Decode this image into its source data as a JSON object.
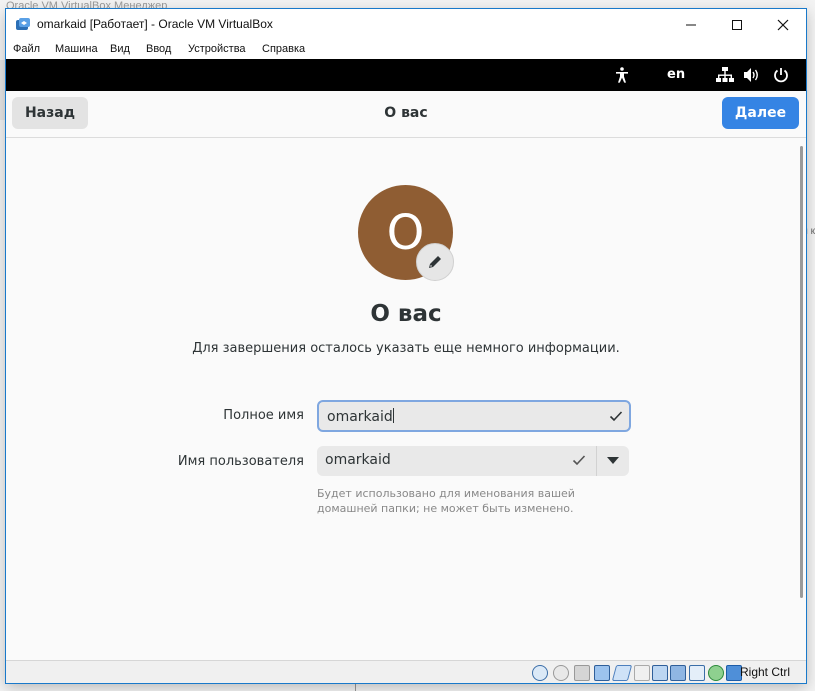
{
  "background": {
    "window_title_peek": "Oracle VM VirtualBox Менеджер",
    "right_edge_text": "и к"
  },
  "window": {
    "title": "omarkaid [Работает] - Oracle VM VirtualBox",
    "menu": [
      "Файл",
      "Машина",
      "Вид",
      "Ввод",
      "Устройства",
      "Справка"
    ]
  },
  "gnome_topbar": {
    "icons": [
      "accessibility-icon",
      "network-icon",
      "volume-icon",
      "power-icon"
    ],
    "language": "en"
  },
  "header": {
    "back_label": "Назад",
    "title": "О вас",
    "next_label": "Далее"
  },
  "content": {
    "avatar_letter": "O",
    "heading": "О вас",
    "subtitle": "Для завершения осталось указать еще немного информации.",
    "full_name_label": "Полное имя",
    "full_name_value": "omarkaid",
    "username_label": "Имя пользователя",
    "username_value": "omarkaid",
    "username_hint": "Будет использовано для именования вашей домашней папки; не может быть изменено."
  },
  "statusbar": {
    "host_key": "Right Ctrl"
  },
  "colors": {
    "accent": "#3584e4",
    "avatar": "#8f5d33",
    "titlebar_border": "#1979ca"
  }
}
